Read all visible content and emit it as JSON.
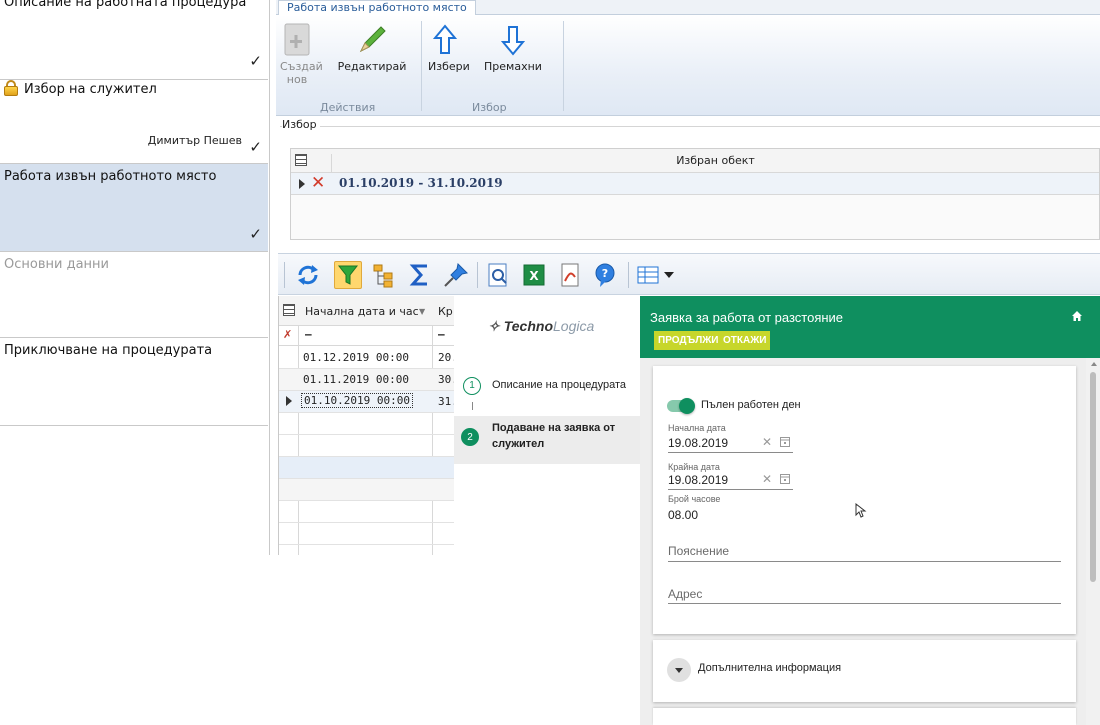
{
  "steps": [
    {
      "title": "Описание на работната процедура",
      "done": "✓"
    },
    {
      "title": "Избор на служител",
      "assignee": "Димитър Пешев",
      "done": "✓"
    },
    {
      "title": "Работа извън работното място",
      "done": "✓"
    },
    {
      "title": "Основни данни"
    },
    {
      "title": "Приключване на процедурата"
    }
  ],
  "ribbon": {
    "tab": "Работа извън работното място",
    "buttons": {
      "create_line1": "Създай",
      "create_line2": "нов",
      "edit": "Редактирай",
      "select": "Избери",
      "remove": "Премахни"
    },
    "groups": {
      "actions": "Действия",
      "selection": "Избор"
    }
  },
  "selection": {
    "label": "Избор",
    "column": "Избран обект",
    "value": "01.10.2019 - 31.10.2019"
  },
  "grid": {
    "col_start": "Начална дата и час",
    "col_end": "Кр",
    "filter_dash": "–",
    "rows": [
      {
        "start": "01.12.2019 00:00",
        "end": "20."
      },
      {
        "start": "01.11.2019 00:00",
        "end": "30."
      },
      {
        "start": "01.10.2019 00:00",
        "end": "31."
      }
    ]
  },
  "web": {
    "logo_a": "Techno",
    "logo_b": "Logica",
    "title": "Заявка за работа от разстояние",
    "btn_continue": "ПРОДЪЛЖИ",
    "btn_cancel": "ОТКАЖИ",
    "wizard": [
      {
        "num": "1",
        "label": "Описание на процедурата"
      },
      {
        "num": "2",
        "label_line1": "Подаване на заявка от",
        "label_line2": "служител"
      }
    ],
    "full_day": "Пълен работен ден",
    "start_label": "Начална дата",
    "start_value": "19.08.2019",
    "end_label": "Крайна дата",
    "end_value": "19.08.2019",
    "hours_label": "Брой часове",
    "hours_value": "08.00",
    "note_placeholder": "Пояснение",
    "address_placeholder": "Адрес",
    "extra_info": "Допълнителна информация"
  },
  "colors": {
    "accent_green": "#0f8f5f",
    "button_lime": "#c7d62b",
    "selected_step": "#d5e0ee"
  }
}
